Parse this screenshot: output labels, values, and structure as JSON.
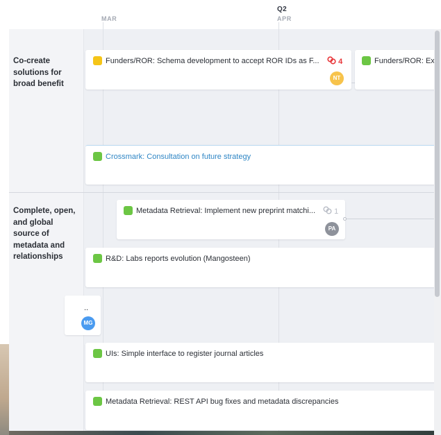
{
  "timeline": {
    "months": [
      {
        "label": "MAR"
      },
      {
        "label": "APR"
      }
    ],
    "quarter": "Q2"
  },
  "lanes": [
    {
      "label": "Co-create solutions for broad benefit"
    },
    {
      "label": "Complete, open, and global source of metadata and relationships"
    }
  ],
  "cards": {
    "funders_ror_schema": {
      "title": "Funders/ROR: Schema development to accept ROR IDs as F...",
      "status": "yellow",
      "dependencies": "4",
      "assignee": "NT"
    },
    "funders_ror_exp": {
      "title": "Funders/ROR: Exp",
      "status": "green"
    },
    "crossmark": {
      "title": "Crossmark: Consultation on future strategy",
      "status": "green"
    },
    "metadata_retrieval_preprint": {
      "title": "Metadata Retrieval: Implement new preprint matchi...",
      "status": "green",
      "dependencies": "1",
      "assignee": "PA"
    },
    "rd_labs": {
      "title": "R&D: Labs reports evolution (Mangosteen)",
      "status": "green"
    },
    "partial_card": {
      "title": "..",
      "assignee": "MG"
    },
    "uis_simple": {
      "title": "UIs: Simple interface to register journal articles",
      "status": "green"
    },
    "metadata_retrieval_rest": {
      "title": "Metadata Retrieval: REST API bug fixes and metadata discrepancies",
      "status": "green"
    }
  },
  "colors": {
    "status_green": "#6cc644",
    "status_yellow": "#f5c518",
    "dependency_red": "#e8363a",
    "link_blue": "#2f86c5"
  }
}
